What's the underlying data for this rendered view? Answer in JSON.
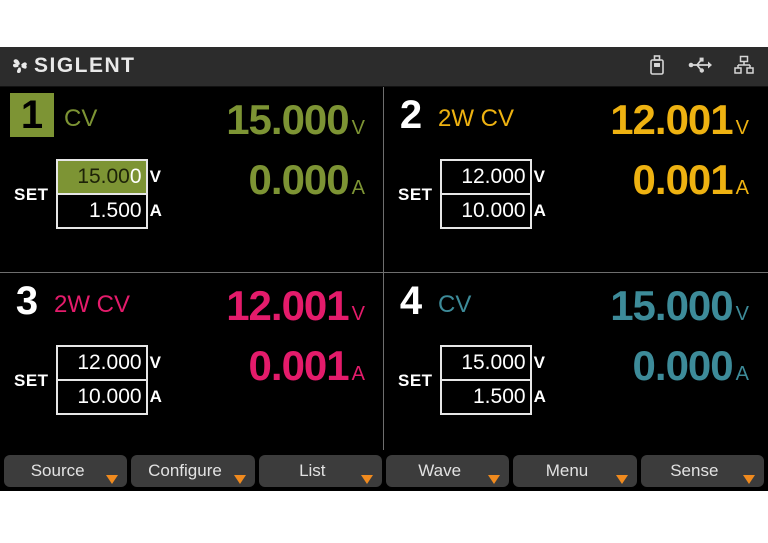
{
  "header": {
    "brand": "SIGLENT",
    "logo_icon": "siglent-fan-logo-icon",
    "status_icons": [
      {
        "name": "usb-flash-drive-icon",
        "label": "USB Storage"
      },
      {
        "name": "usb-connector-icon",
        "label": "USB Device"
      },
      {
        "name": "lan-network-icon",
        "label": "LAN"
      }
    ]
  },
  "channels": [
    {
      "number": "1",
      "mode": "CV",
      "color": "#7d9434",
      "selected": true,
      "set_label": "SET",
      "set_voltage": "15.000",
      "set_voltage_cursor_digit": "0",
      "set_voltage_prefix": "15.00",
      "set_voltage_unit": "V",
      "set_current": "1.500",
      "set_current_unit": "A",
      "meas_voltage": "15.000",
      "meas_voltage_unit": "V",
      "meas_current": "0.000",
      "meas_current_unit": "A"
    },
    {
      "number": "2",
      "mode": "2W CV",
      "color": "#eeb211",
      "selected": false,
      "set_label": "SET",
      "set_voltage": "12.000",
      "set_voltage_unit": "V",
      "set_current": "10.000",
      "set_current_unit": "A",
      "meas_voltage": "12.001",
      "meas_voltage_unit": "V",
      "meas_current": "0.001",
      "meas_current_unit": "A"
    },
    {
      "number": "3",
      "mode": "2W CV",
      "color": "#e41b6b",
      "selected": false,
      "set_label": "SET",
      "set_voltage": "12.000",
      "set_voltage_unit": "V",
      "set_current": "10.000",
      "set_current_unit": "A",
      "meas_voltage": "12.001",
      "meas_voltage_unit": "V",
      "meas_current": "0.001",
      "meas_current_unit": "A"
    },
    {
      "number": "4",
      "mode": "CV",
      "color": "#3d8b99",
      "selected": false,
      "set_label": "SET",
      "set_voltage": "15.000",
      "set_voltage_unit": "V",
      "set_current": "1.500",
      "set_current_unit": "A",
      "meas_voltage": "15.000",
      "meas_voltage_unit": "V",
      "meas_current": "0.000",
      "meas_current_unit": "A"
    }
  ],
  "toolbar": {
    "dropdown_color": "#f08a1e",
    "buttons": [
      {
        "label": "Source"
      },
      {
        "label": "Configure"
      },
      {
        "label": "List"
      },
      {
        "label": "Wave"
      },
      {
        "label": "Menu"
      },
      {
        "label": "Sense"
      }
    ]
  }
}
